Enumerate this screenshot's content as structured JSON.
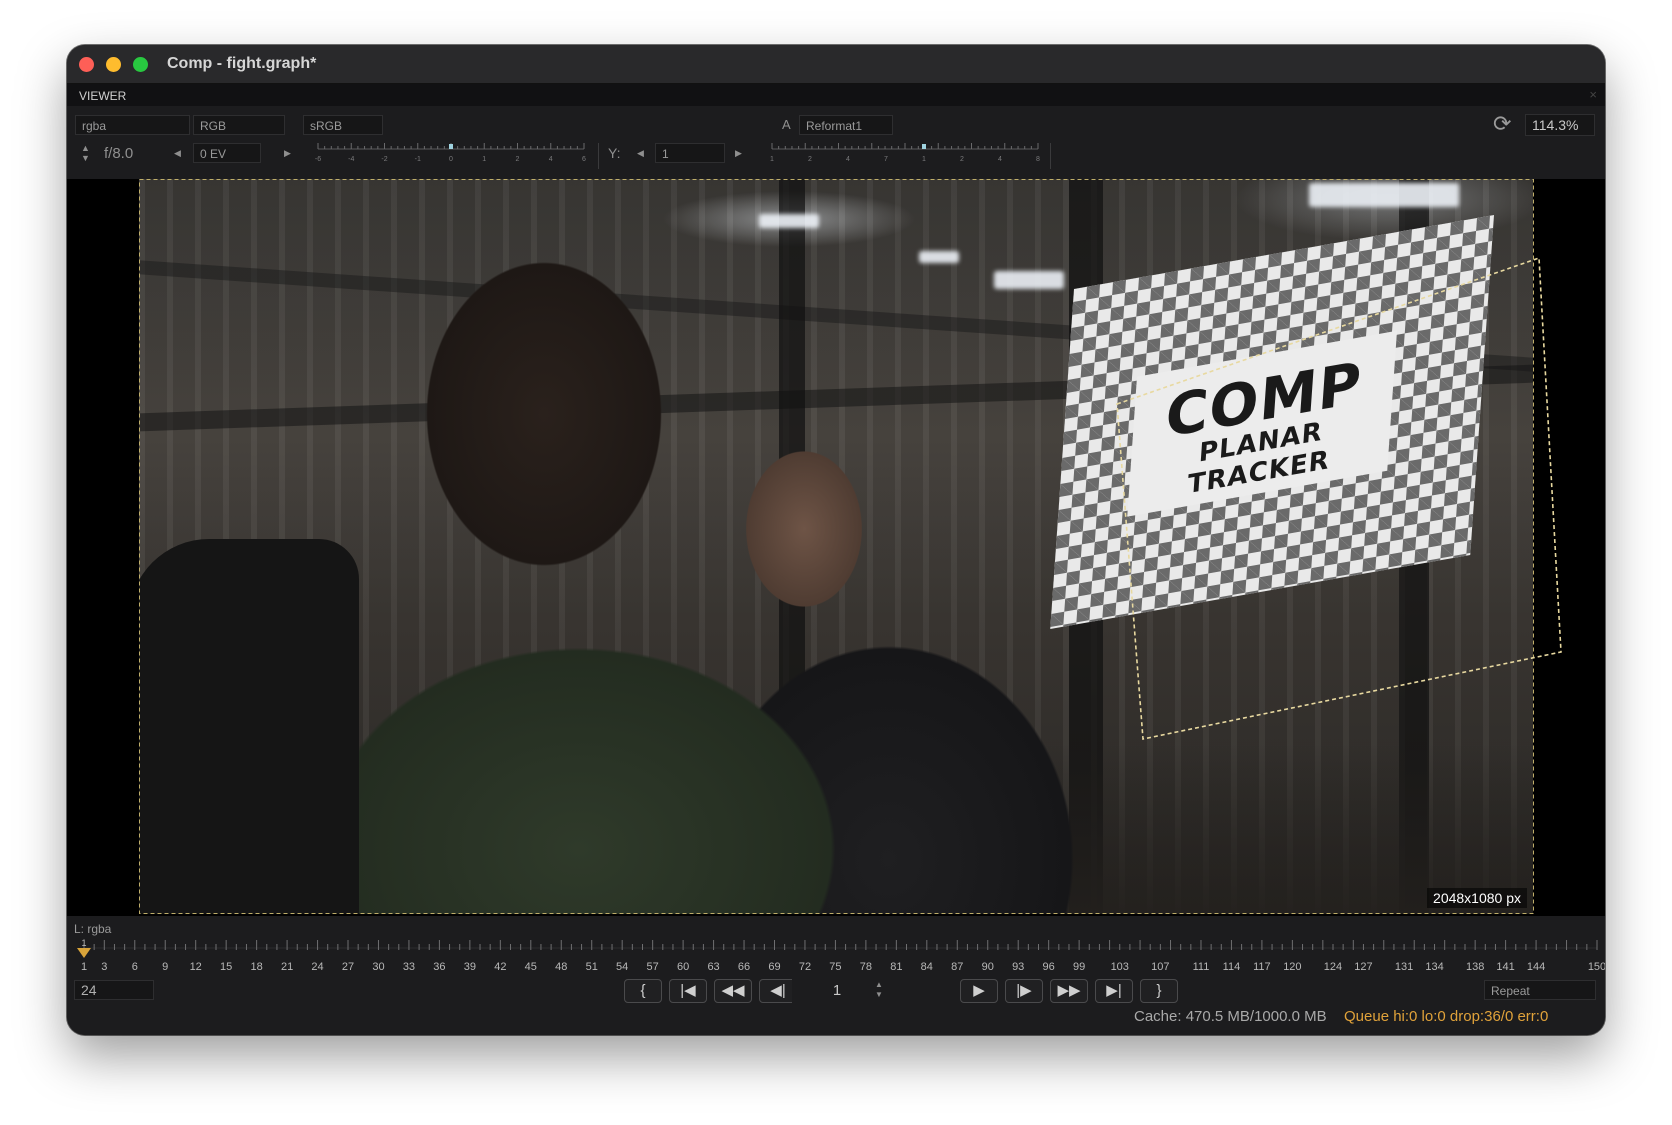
{
  "window": {
    "title": "Comp - fight.graph*"
  },
  "panel": {
    "label": "VIEWER",
    "close": "×"
  },
  "toolbar": {
    "channels": "rgba",
    "colorspace": "RGB",
    "display": "sRGB",
    "input_label": "A",
    "input_node": "Reformat1",
    "fstop": "f/8.0",
    "exposure": "0 EV",
    "exposure_ticks": [
      "-6",
      "-4",
      "-2",
      "-1",
      "0",
      "1",
      "2",
      "4",
      "6"
    ],
    "gamma_label": "Y:",
    "gamma": "1",
    "gamma_ticks": [
      "1",
      "2",
      "4",
      "7",
      "1",
      "2",
      "4",
      "8"
    ],
    "zoom": "114.3%"
  },
  "viewport": {
    "resolution": "2048x1080 px",
    "sign_text_main": "COMP",
    "sign_text_sub": "PLANAR TRACKER"
  },
  "bottom": {
    "layer": "L: rgba",
    "current_frame_marker": "1",
    "timeline_labels": [
      "1",
      "3",
      "6",
      "9",
      "12",
      "15",
      "18",
      "21",
      "24",
      "27",
      "30",
      "33",
      "36",
      "39",
      "42",
      "45",
      "48",
      "51",
      "54",
      "57",
      "60",
      "63",
      "66",
      "69",
      "72",
      "75",
      "78",
      "81",
      "84",
      "87",
      "90",
      "93",
      "96",
      "99",
      "103",
      "107",
      "111",
      "114",
      "117",
      "120",
      "124",
      "127",
      "131",
      "134",
      "138",
      "141",
      "144",
      "150"
    ],
    "fps": "24",
    "frame": "1",
    "loop_mode": "Repeat",
    "transport": {
      "in_point": "{",
      "first": "⏮",
      "prev_key": "⏪",
      "step_back": "◀|",
      "play_back": "◀",
      "play": "▶",
      "step_fwd": "|▶",
      "next_key": "⏩",
      "last": "⏭",
      "out_point": "}"
    },
    "cache": "Cache: 470.5 MB/1000.0 MB",
    "queue": "Queue hi:0 lo:0 drop:36/0 err:0"
  },
  "colors": {
    "accent": "#e0a23a",
    "marker": "#d9a43a",
    "tracker_outline": "#e8d9a0"
  }
}
